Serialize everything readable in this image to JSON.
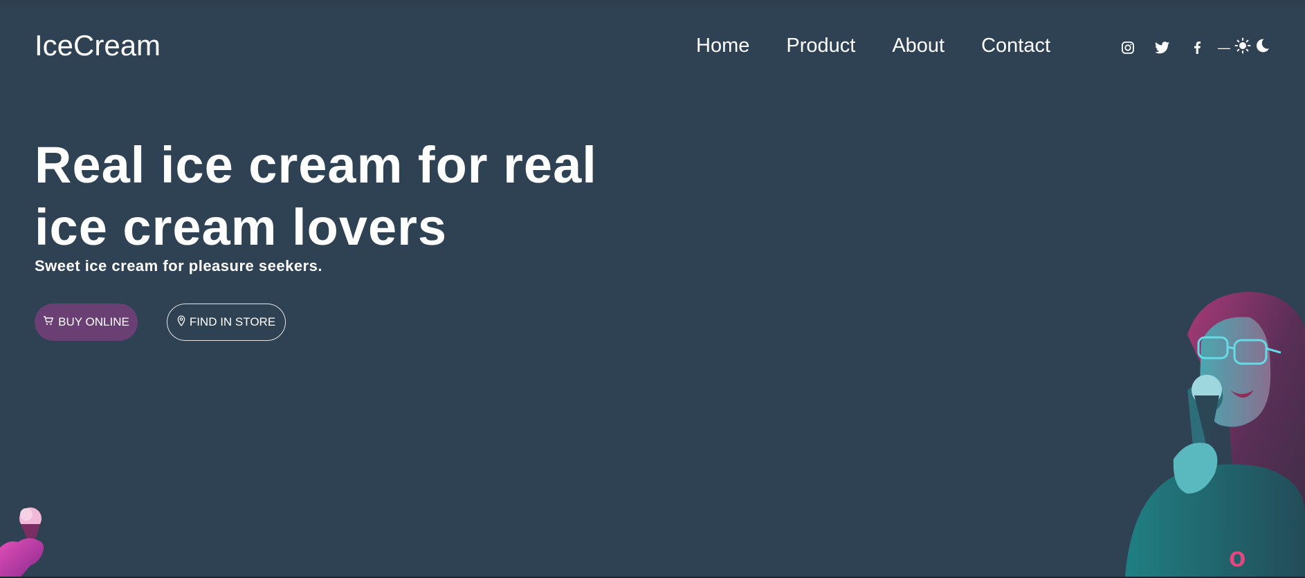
{
  "brand": {
    "logo": "IceCream"
  },
  "nav": {
    "items": [
      "Home",
      "Product",
      "About",
      "Contact"
    ]
  },
  "social": {
    "icons": [
      "instagram-icon",
      "twitter-icon",
      "facebook-icon"
    ],
    "separator": "—",
    "theme_icons": [
      "sun-icon",
      "moon-icon"
    ]
  },
  "hero": {
    "title_line1": "Real ice cream for real",
    "title_line2": "ice cream lovers",
    "subtitle": "Sweet ice cream for pleasure seekers.",
    "buy_button": "BUY ONLINE",
    "find_button": "FIND IN STORE"
  },
  "colors": {
    "background": "#2f4254",
    "buy_button": "#6a3f74",
    "text": "#ffffff"
  }
}
